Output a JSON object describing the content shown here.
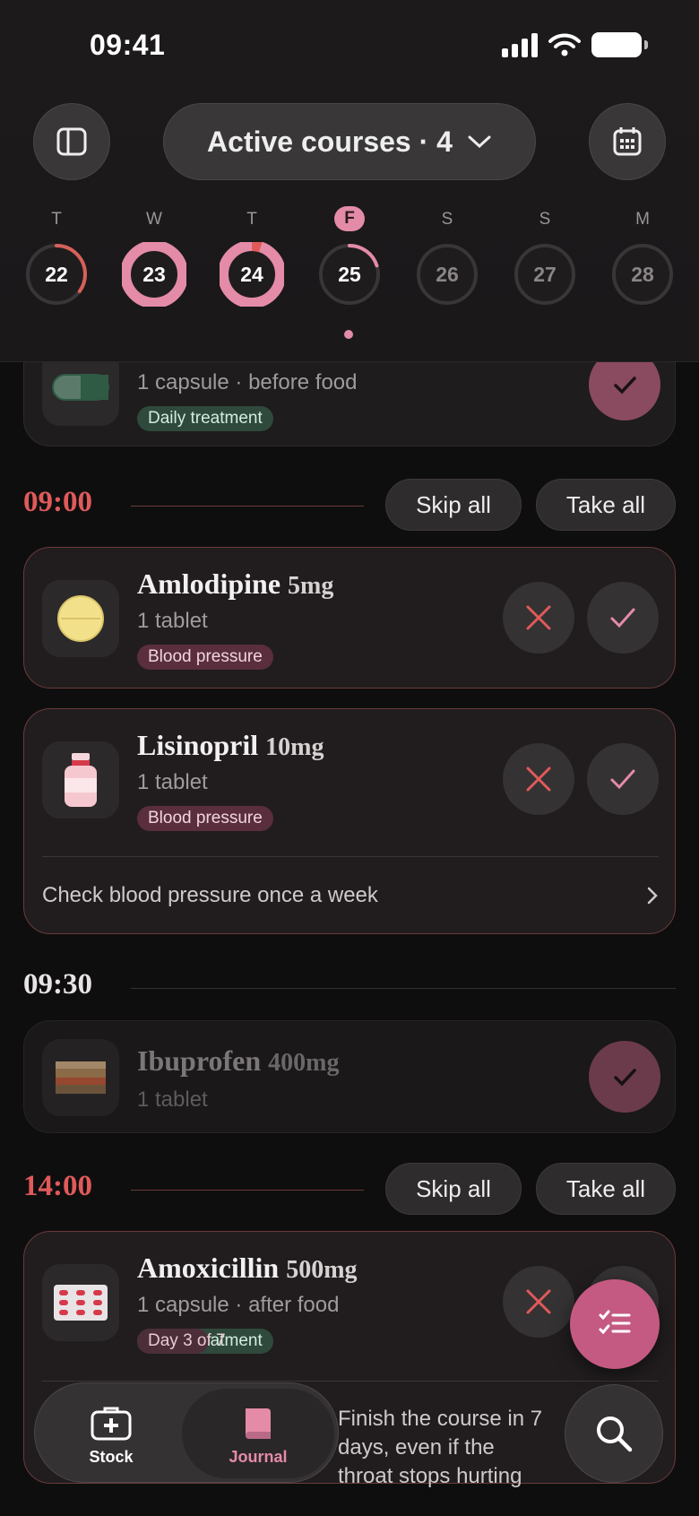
{
  "status": {
    "time": "09:41"
  },
  "header": {
    "course_label": "Active courses · 4"
  },
  "week": [
    {
      "letter": "T",
      "date": "22",
      "progress": 0.35,
      "state": "partial"
    },
    {
      "letter": "W",
      "date": "23",
      "progress": 1.0,
      "state": "full"
    },
    {
      "letter": "T",
      "date": "24",
      "progress": 0.95,
      "state": "full-missed"
    },
    {
      "letter": "F",
      "date": "25",
      "progress": 0.2,
      "state": "today"
    },
    {
      "letter": "S",
      "date": "26",
      "progress": 0,
      "state": "future"
    },
    {
      "letter": "S",
      "date": "27",
      "progress": 0,
      "state": "future"
    },
    {
      "letter": "M",
      "date": "28",
      "progress": 0,
      "state": "future"
    }
  ],
  "partial_card": {
    "sub": "1 capsule · before food",
    "tag": "Daily treatment"
  },
  "groups": [
    {
      "time": "09:00",
      "skip": "Skip all",
      "take": "Take all"
    },
    {
      "time": "09:30"
    },
    {
      "time": "14:00",
      "skip": "Skip all",
      "take": "Take all"
    }
  ],
  "meds": {
    "amlodipine": {
      "name": "Amlodipine",
      "dose": "5mg",
      "sub": "1 tablet",
      "tag": "Blood pressure"
    },
    "lisinopril": {
      "name": "Lisinopril",
      "dose": "10mg",
      "sub": "1 tablet",
      "tag": "Blood pressure",
      "note": "Check blood pressure once a week"
    },
    "ibuprofen": {
      "name": "Ibuprofen",
      "dose": "400mg",
      "sub": "1 tablet"
    },
    "amoxicillin": {
      "name": "Amoxicillin",
      "dose": "500mg",
      "sub": "1 capsule · after food",
      "tag1": "Daily treatment",
      "tag2": "Day 3 of 7",
      "note": "Finish the course in 7 days, even if the throat stops hurting"
    }
  },
  "tabbar": {
    "stock": "Stock",
    "journal": "Journal"
  },
  "colors": {
    "accent": "#e48ba8",
    "due": "#e05a5a",
    "fab": "#c45a82"
  }
}
